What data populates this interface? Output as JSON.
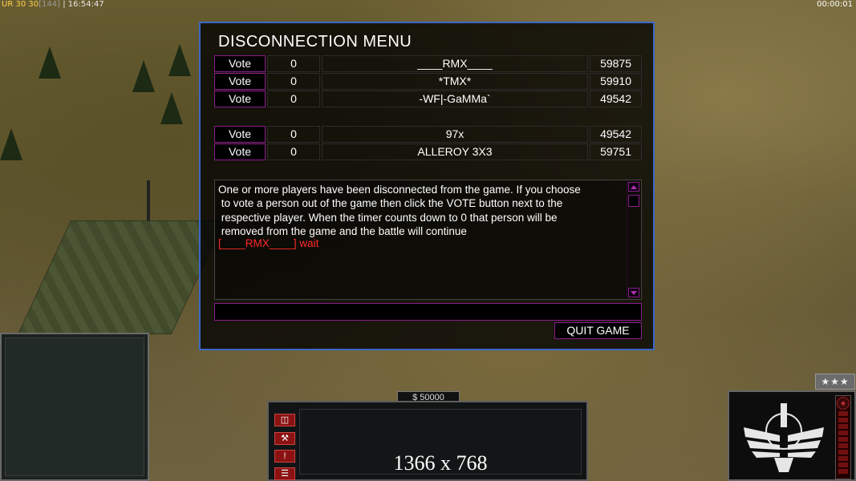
{
  "hud": {
    "version": "UR",
    "fps_a": "30",
    "fps_b": "30",
    "ping": "[144]",
    "sep": "|",
    "clock": "16:54:47",
    "timer": "00:00:01"
  },
  "dialog": {
    "title": "DISCONNECTION MENU",
    "vote_label": "Vote",
    "players": [
      {
        "votes": "0",
        "name": "____RMX____",
        "ping": "59875"
      },
      {
        "votes": "0",
        "name": "*TMX*",
        "ping": "59910"
      },
      {
        "votes": "0",
        "name": "-WF|-GaMMa`",
        "ping": "49542"
      },
      {
        "votes": "0",
        "name": "97x",
        "ping": "49542"
      },
      {
        "votes": "0",
        "name": "ALLEROY 3X3",
        "ping": "59751"
      }
    ],
    "message": "One or more players have been disconnected from the game. If you choose\n to vote a person out of the game then click the VOTE button next to the\n respective player. When the timer counts down to 0 that person will be\n removed from the game and the battle will continue",
    "wait_line": "[____RMX____] wait",
    "chat_value": "",
    "quit_label": "QUIT GAME"
  },
  "bottom": {
    "money": "$ 50000",
    "resolution": "1366 x 768",
    "rank": "★★★"
  },
  "colors": {
    "accent_border": "#3a67c8",
    "button_border": "#8b1b8b",
    "wait_text": "#ff2a2a"
  },
  "icons": [
    "structures-icon",
    "wrench-icon",
    "alert-icon",
    "options-icon",
    "star-icon",
    "faction-emblem-icon"
  ]
}
